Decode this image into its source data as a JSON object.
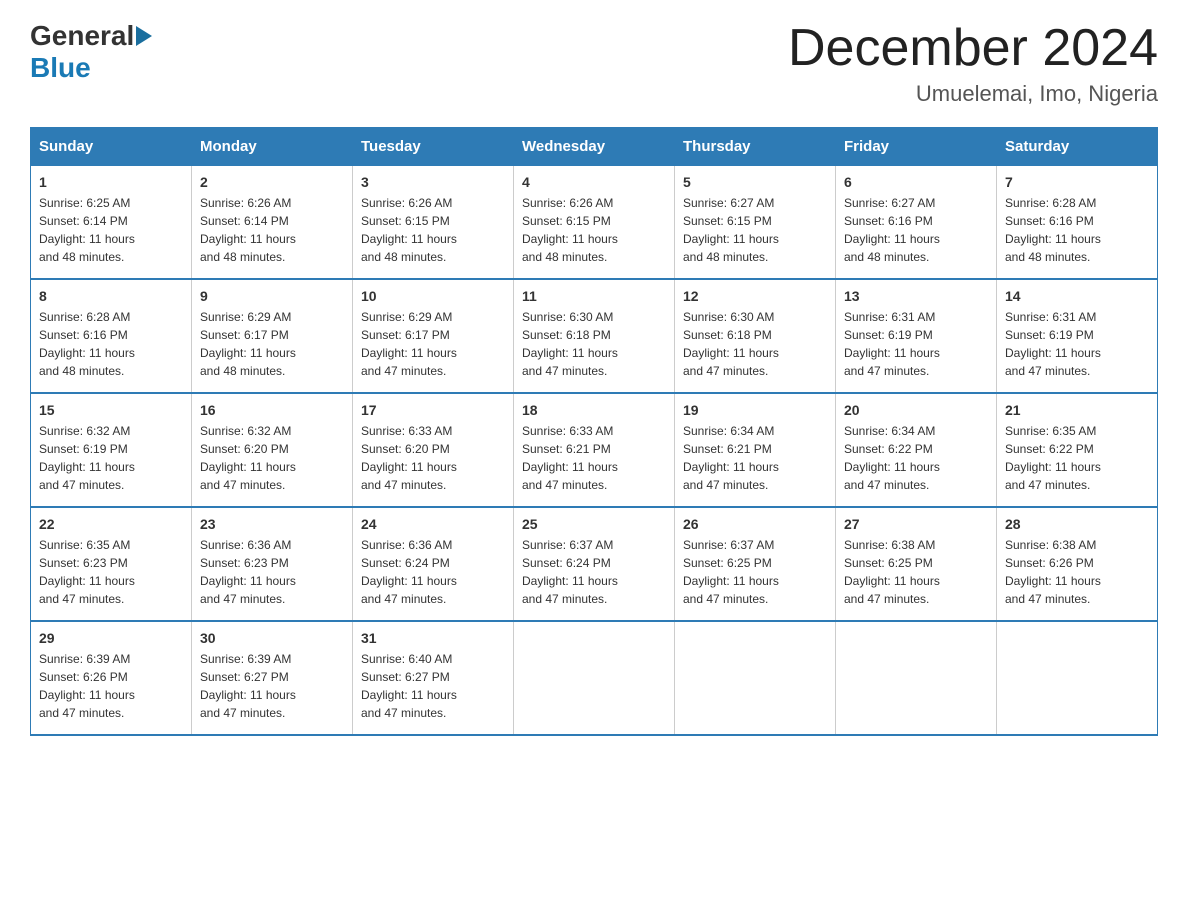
{
  "logo": {
    "general": "General",
    "blue": "Blue"
  },
  "title": "December 2024",
  "location": "Umuelemai, Imo, Nigeria",
  "days_of_week": [
    "Sunday",
    "Monday",
    "Tuesday",
    "Wednesday",
    "Thursday",
    "Friday",
    "Saturday"
  ],
  "weeks": [
    [
      {
        "day": "1",
        "sunrise": "6:25 AM",
        "sunset": "6:14 PM",
        "daylight": "11 hours and 48 minutes."
      },
      {
        "day": "2",
        "sunrise": "6:26 AM",
        "sunset": "6:14 PM",
        "daylight": "11 hours and 48 minutes."
      },
      {
        "day": "3",
        "sunrise": "6:26 AM",
        "sunset": "6:15 PM",
        "daylight": "11 hours and 48 minutes."
      },
      {
        "day": "4",
        "sunrise": "6:26 AM",
        "sunset": "6:15 PM",
        "daylight": "11 hours and 48 minutes."
      },
      {
        "day": "5",
        "sunrise": "6:27 AM",
        "sunset": "6:15 PM",
        "daylight": "11 hours and 48 minutes."
      },
      {
        "day": "6",
        "sunrise": "6:27 AM",
        "sunset": "6:16 PM",
        "daylight": "11 hours and 48 minutes."
      },
      {
        "day": "7",
        "sunrise": "6:28 AM",
        "sunset": "6:16 PM",
        "daylight": "11 hours and 48 minutes."
      }
    ],
    [
      {
        "day": "8",
        "sunrise": "6:28 AM",
        "sunset": "6:16 PM",
        "daylight": "11 hours and 48 minutes."
      },
      {
        "day": "9",
        "sunrise": "6:29 AM",
        "sunset": "6:17 PM",
        "daylight": "11 hours and 48 minutes."
      },
      {
        "day": "10",
        "sunrise": "6:29 AM",
        "sunset": "6:17 PM",
        "daylight": "11 hours and 47 minutes."
      },
      {
        "day": "11",
        "sunrise": "6:30 AM",
        "sunset": "6:18 PM",
        "daylight": "11 hours and 47 minutes."
      },
      {
        "day": "12",
        "sunrise": "6:30 AM",
        "sunset": "6:18 PM",
        "daylight": "11 hours and 47 minutes."
      },
      {
        "day": "13",
        "sunrise": "6:31 AM",
        "sunset": "6:19 PM",
        "daylight": "11 hours and 47 minutes."
      },
      {
        "day": "14",
        "sunrise": "6:31 AM",
        "sunset": "6:19 PM",
        "daylight": "11 hours and 47 minutes."
      }
    ],
    [
      {
        "day": "15",
        "sunrise": "6:32 AM",
        "sunset": "6:19 PM",
        "daylight": "11 hours and 47 minutes."
      },
      {
        "day": "16",
        "sunrise": "6:32 AM",
        "sunset": "6:20 PM",
        "daylight": "11 hours and 47 minutes."
      },
      {
        "day": "17",
        "sunrise": "6:33 AM",
        "sunset": "6:20 PM",
        "daylight": "11 hours and 47 minutes."
      },
      {
        "day": "18",
        "sunrise": "6:33 AM",
        "sunset": "6:21 PM",
        "daylight": "11 hours and 47 minutes."
      },
      {
        "day": "19",
        "sunrise": "6:34 AM",
        "sunset": "6:21 PM",
        "daylight": "11 hours and 47 minutes."
      },
      {
        "day": "20",
        "sunrise": "6:34 AM",
        "sunset": "6:22 PM",
        "daylight": "11 hours and 47 minutes."
      },
      {
        "day": "21",
        "sunrise": "6:35 AM",
        "sunset": "6:22 PM",
        "daylight": "11 hours and 47 minutes."
      }
    ],
    [
      {
        "day": "22",
        "sunrise": "6:35 AM",
        "sunset": "6:23 PM",
        "daylight": "11 hours and 47 minutes."
      },
      {
        "day": "23",
        "sunrise": "6:36 AM",
        "sunset": "6:23 PM",
        "daylight": "11 hours and 47 minutes."
      },
      {
        "day": "24",
        "sunrise": "6:36 AM",
        "sunset": "6:24 PM",
        "daylight": "11 hours and 47 minutes."
      },
      {
        "day": "25",
        "sunrise": "6:37 AM",
        "sunset": "6:24 PM",
        "daylight": "11 hours and 47 minutes."
      },
      {
        "day": "26",
        "sunrise": "6:37 AM",
        "sunset": "6:25 PM",
        "daylight": "11 hours and 47 minutes."
      },
      {
        "day": "27",
        "sunrise": "6:38 AM",
        "sunset": "6:25 PM",
        "daylight": "11 hours and 47 minutes."
      },
      {
        "day": "28",
        "sunrise": "6:38 AM",
        "sunset": "6:26 PM",
        "daylight": "11 hours and 47 minutes."
      }
    ],
    [
      {
        "day": "29",
        "sunrise": "6:39 AM",
        "sunset": "6:26 PM",
        "daylight": "11 hours and 47 minutes."
      },
      {
        "day": "30",
        "sunrise": "6:39 AM",
        "sunset": "6:27 PM",
        "daylight": "11 hours and 47 minutes."
      },
      {
        "day": "31",
        "sunrise": "6:40 AM",
        "sunset": "6:27 PM",
        "daylight": "11 hours and 47 minutes."
      },
      null,
      null,
      null,
      null
    ]
  ],
  "labels": {
    "sunrise": "Sunrise:",
    "sunset": "Sunset:",
    "daylight": "Daylight:"
  }
}
